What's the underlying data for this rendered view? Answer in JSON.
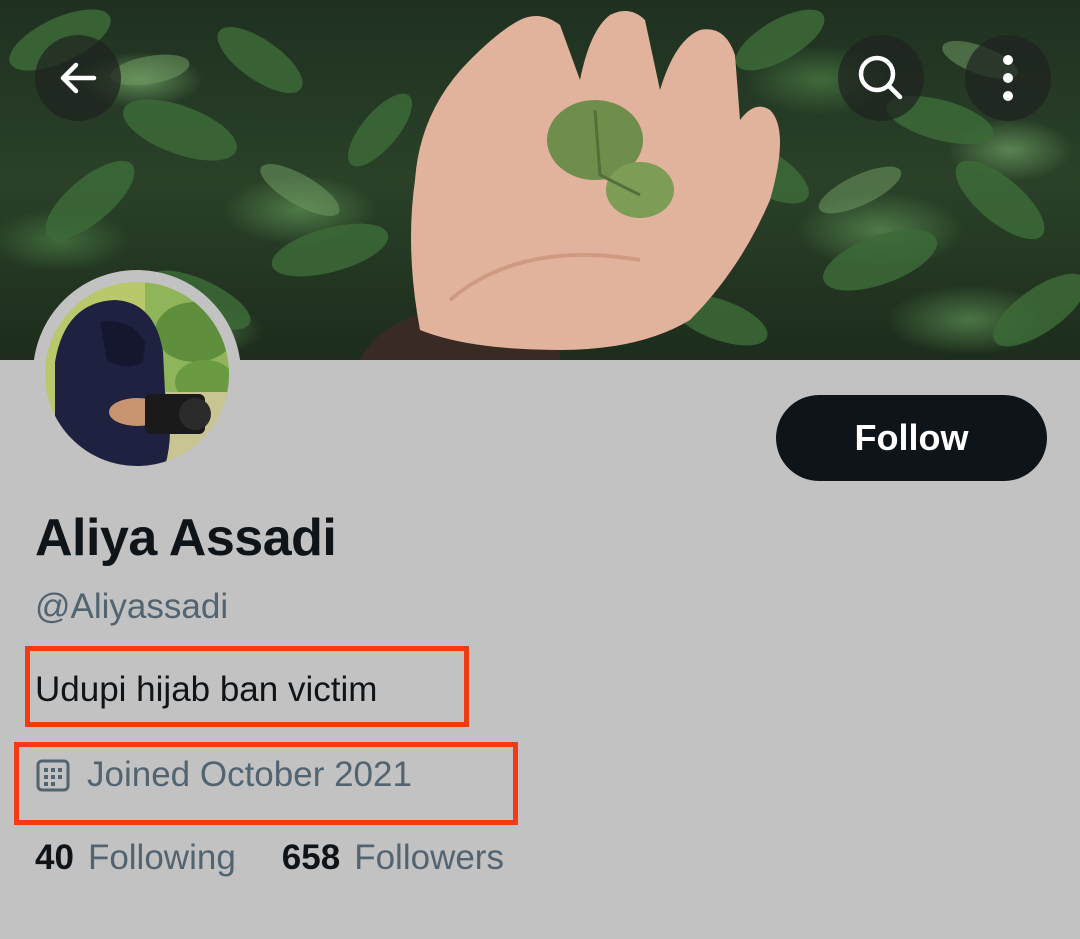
{
  "profile": {
    "display_name": "Aliya Assadi",
    "handle": "@Aliyassadi",
    "bio": "Udupi hijab ban victim",
    "joined": "Joined October 2021",
    "following_count": "40",
    "following_label": "Following",
    "followers_count": "658",
    "followers_label": "Followers"
  },
  "actions": {
    "follow_label": "Follow"
  },
  "icons": {
    "back": "arrow-left-icon",
    "search": "search-icon",
    "more": "more-vertical-icon",
    "calendar": "calendar-icon"
  },
  "colors": {
    "page_background": "#c2c2c2",
    "primary_text": "#0f1419",
    "secondary_text": "#536471",
    "follow_button_bg": "#0f1419",
    "follow_button_text": "#ffffff",
    "highlight_border": "#f23a14"
  }
}
